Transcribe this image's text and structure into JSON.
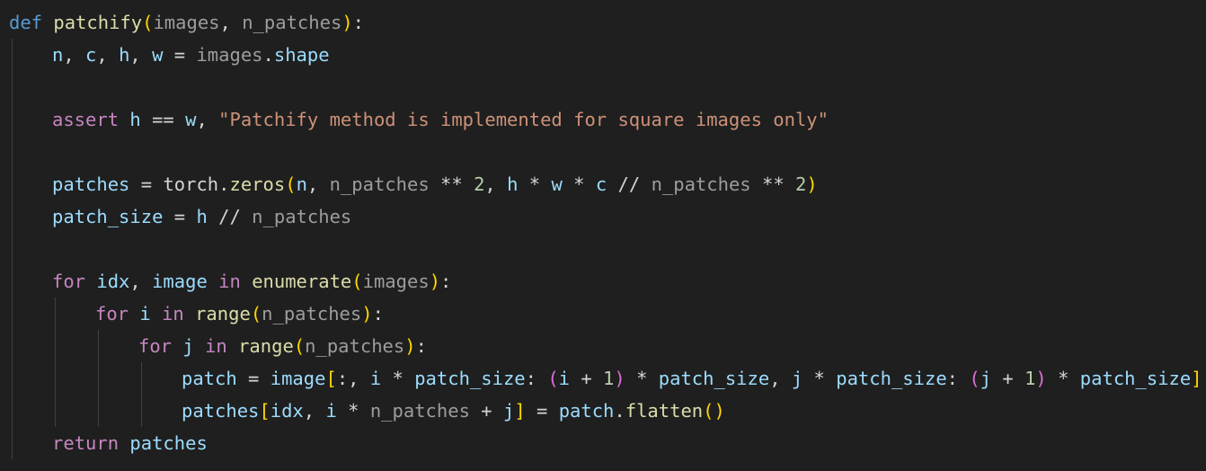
{
  "colors": {
    "background": "#1f1f1f",
    "indent_guide": "#404040",
    "keyword_def": "#569cd6",
    "keyword_control": "#c586c0",
    "function": "#dcdcaa",
    "parameter": "#9cdcfe",
    "variable": "#9cdcfe",
    "plain": "#d4d4d4",
    "string": "#ce9178",
    "number": "#b5cea8",
    "bracket1": "#ffd700",
    "bracket2": "#da70d6",
    "bracket3": "#179fff",
    "dimmed": "#9d9d9d"
  },
  "editor": {
    "language": "python",
    "lines": [
      {
        "indent": 0,
        "tokens": [
          {
            "t": "def",
            "c": "keyword_def"
          },
          {
            "t": " ",
            "c": "plain"
          },
          {
            "t": "patchify",
            "c": "function"
          },
          {
            "t": "(",
            "c": "bracket1"
          },
          {
            "t": "images",
            "c": "dimmed"
          },
          {
            "t": ", ",
            "c": "plain"
          },
          {
            "t": "n_patches",
            "c": "dimmed"
          },
          {
            "t": ")",
            "c": "bracket1"
          },
          {
            "t": ":",
            "c": "plain"
          }
        ]
      },
      {
        "indent": 1,
        "tokens": [
          {
            "t": "n",
            "c": "variable"
          },
          {
            "t": ", ",
            "c": "plain"
          },
          {
            "t": "c",
            "c": "variable"
          },
          {
            "t": ", ",
            "c": "plain"
          },
          {
            "t": "h",
            "c": "variable"
          },
          {
            "t": ", ",
            "c": "plain"
          },
          {
            "t": "w",
            "c": "variable"
          },
          {
            "t": " = ",
            "c": "plain"
          },
          {
            "t": "images",
            "c": "dimmed"
          },
          {
            "t": ".",
            "c": "plain"
          },
          {
            "t": "shape",
            "c": "variable"
          }
        ]
      },
      {
        "indent": 1,
        "tokens": []
      },
      {
        "indent": 1,
        "tokens": [
          {
            "t": "assert",
            "c": "keyword_control"
          },
          {
            "t": " ",
            "c": "plain"
          },
          {
            "t": "h",
            "c": "variable"
          },
          {
            "t": " == ",
            "c": "plain"
          },
          {
            "t": "w",
            "c": "variable"
          },
          {
            "t": ", ",
            "c": "plain"
          },
          {
            "t": "\"Patchify method is implemented for square images only\"",
            "c": "string"
          }
        ]
      },
      {
        "indent": 1,
        "tokens": []
      },
      {
        "indent": 1,
        "tokens": [
          {
            "t": "patches",
            "c": "variable"
          },
          {
            "t": " = ",
            "c": "plain"
          },
          {
            "t": "torch",
            "c": "plain"
          },
          {
            "t": ".",
            "c": "plain"
          },
          {
            "t": "zeros",
            "c": "function"
          },
          {
            "t": "(",
            "c": "bracket1"
          },
          {
            "t": "n",
            "c": "variable"
          },
          {
            "t": ", ",
            "c": "plain"
          },
          {
            "t": "n_patches",
            "c": "dimmed"
          },
          {
            "t": " ** ",
            "c": "plain"
          },
          {
            "t": "2",
            "c": "number"
          },
          {
            "t": ", ",
            "c": "plain"
          },
          {
            "t": "h",
            "c": "variable"
          },
          {
            "t": " * ",
            "c": "plain"
          },
          {
            "t": "w",
            "c": "variable"
          },
          {
            "t": " * ",
            "c": "plain"
          },
          {
            "t": "c",
            "c": "variable"
          },
          {
            "t": " // ",
            "c": "plain"
          },
          {
            "t": "n_patches",
            "c": "dimmed"
          },
          {
            "t": " ** ",
            "c": "plain"
          },
          {
            "t": "2",
            "c": "number"
          },
          {
            "t": ")",
            "c": "bracket1"
          }
        ]
      },
      {
        "indent": 1,
        "tokens": [
          {
            "t": "patch_size",
            "c": "variable"
          },
          {
            "t": " = ",
            "c": "plain"
          },
          {
            "t": "h",
            "c": "variable"
          },
          {
            "t": " // ",
            "c": "plain"
          },
          {
            "t": "n_patches",
            "c": "dimmed"
          }
        ]
      },
      {
        "indent": 1,
        "tokens": []
      },
      {
        "indent": 1,
        "tokens": [
          {
            "t": "for",
            "c": "keyword_control"
          },
          {
            "t": " ",
            "c": "plain"
          },
          {
            "t": "idx",
            "c": "variable"
          },
          {
            "t": ", ",
            "c": "plain"
          },
          {
            "t": "image",
            "c": "variable"
          },
          {
            "t": " ",
            "c": "plain"
          },
          {
            "t": "in",
            "c": "keyword_control"
          },
          {
            "t": " ",
            "c": "plain"
          },
          {
            "t": "enumerate",
            "c": "function"
          },
          {
            "t": "(",
            "c": "bracket1"
          },
          {
            "t": "images",
            "c": "dimmed"
          },
          {
            "t": ")",
            "c": "bracket1"
          },
          {
            "t": ":",
            "c": "plain"
          }
        ]
      },
      {
        "indent": 2,
        "tokens": [
          {
            "t": "for",
            "c": "keyword_control"
          },
          {
            "t": " ",
            "c": "plain"
          },
          {
            "t": "i",
            "c": "variable"
          },
          {
            "t": " ",
            "c": "plain"
          },
          {
            "t": "in",
            "c": "keyword_control"
          },
          {
            "t": " ",
            "c": "plain"
          },
          {
            "t": "range",
            "c": "function"
          },
          {
            "t": "(",
            "c": "bracket1"
          },
          {
            "t": "n_patches",
            "c": "dimmed"
          },
          {
            "t": ")",
            "c": "bracket1"
          },
          {
            "t": ":",
            "c": "plain"
          }
        ]
      },
      {
        "indent": 3,
        "tokens": [
          {
            "t": "for",
            "c": "keyword_control"
          },
          {
            "t": " ",
            "c": "plain"
          },
          {
            "t": "j",
            "c": "variable"
          },
          {
            "t": " ",
            "c": "plain"
          },
          {
            "t": "in",
            "c": "keyword_control"
          },
          {
            "t": " ",
            "c": "plain"
          },
          {
            "t": "range",
            "c": "function"
          },
          {
            "t": "(",
            "c": "bracket1"
          },
          {
            "t": "n_patches",
            "c": "dimmed"
          },
          {
            "t": ")",
            "c": "bracket1"
          },
          {
            "t": ":",
            "c": "plain"
          }
        ]
      },
      {
        "indent": 4,
        "tokens": [
          {
            "t": "patch",
            "c": "variable"
          },
          {
            "t": " = ",
            "c": "plain"
          },
          {
            "t": "image",
            "c": "variable"
          },
          {
            "t": "[",
            "c": "bracket1"
          },
          {
            "t": ":, ",
            "c": "plain"
          },
          {
            "t": "i",
            "c": "variable"
          },
          {
            "t": " * ",
            "c": "plain"
          },
          {
            "t": "patch_size",
            "c": "variable"
          },
          {
            "t": ": ",
            "c": "plain"
          },
          {
            "t": "(",
            "c": "bracket2"
          },
          {
            "t": "i",
            "c": "variable"
          },
          {
            "t": " + ",
            "c": "plain"
          },
          {
            "t": "1",
            "c": "number"
          },
          {
            "t": ")",
            "c": "bracket2"
          },
          {
            "t": " * ",
            "c": "plain"
          },
          {
            "t": "patch_size",
            "c": "variable"
          },
          {
            "t": ", ",
            "c": "plain"
          },
          {
            "t": "j",
            "c": "variable"
          },
          {
            "t": " * ",
            "c": "plain"
          },
          {
            "t": "patch_size",
            "c": "variable"
          },
          {
            "t": ": ",
            "c": "plain"
          },
          {
            "t": "(",
            "c": "bracket2"
          },
          {
            "t": "j",
            "c": "variable"
          },
          {
            "t": " + ",
            "c": "plain"
          },
          {
            "t": "1",
            "c": "number"
          },
          {
            "t": ")",
            "c": "bracket2"
          },
          {
            "t": " * ",
            "c": "plain"
          },
          {
            "t": "patch_size",
            "c": "variable"
          },
          {
            "t": "]",
            "c": "bracket1"
          }
        ]
      },
      {
        "indent": 4,
        "tokens": [
          {
            "t": "patches",
            "c": "variable"
          },
          {
            "t": "[",
            "c": "bracket1"
          },
          {
            "t": "idx",
            "c": "variable"
          },
          {
            "t": ", ",
            "c": "plain"
          },
          {
            "t": "i",
            "c": "variable"
          },
          {
            "t": " * ",
            "c": "plain"
          },
          {
            "t": "n_patches",
            "c": "dimmed"
          },
          {
            "t": " + ",
            "c": "plain"
          },
          {
            "t": "j",
            "c": "variable"
          },
          {
            "t": "]",
            "c": "bracket1"
          },
          {
            "t": " = ",
            "c": "plain"
          },
          {
            "t": "patch",
            "c": "variable"
          },
          {
            "t": ".",
            "c": "plain"
          },
          {
            "t": "flatten",
            "c": "function"
          },
          {
            "t": "()",
            "c": "bracket1"
          }
        ]
      },
      {
        "indent": 1,
        "tokens": [
          {
            "t": "return",
            "c": "keyword_control"
          },
          {
            "t": " ",
            "c": "plain"
          },
          {
            "t": "patches",
            "c": "variable"
          }
        ]
      }
    ]
  }
}
